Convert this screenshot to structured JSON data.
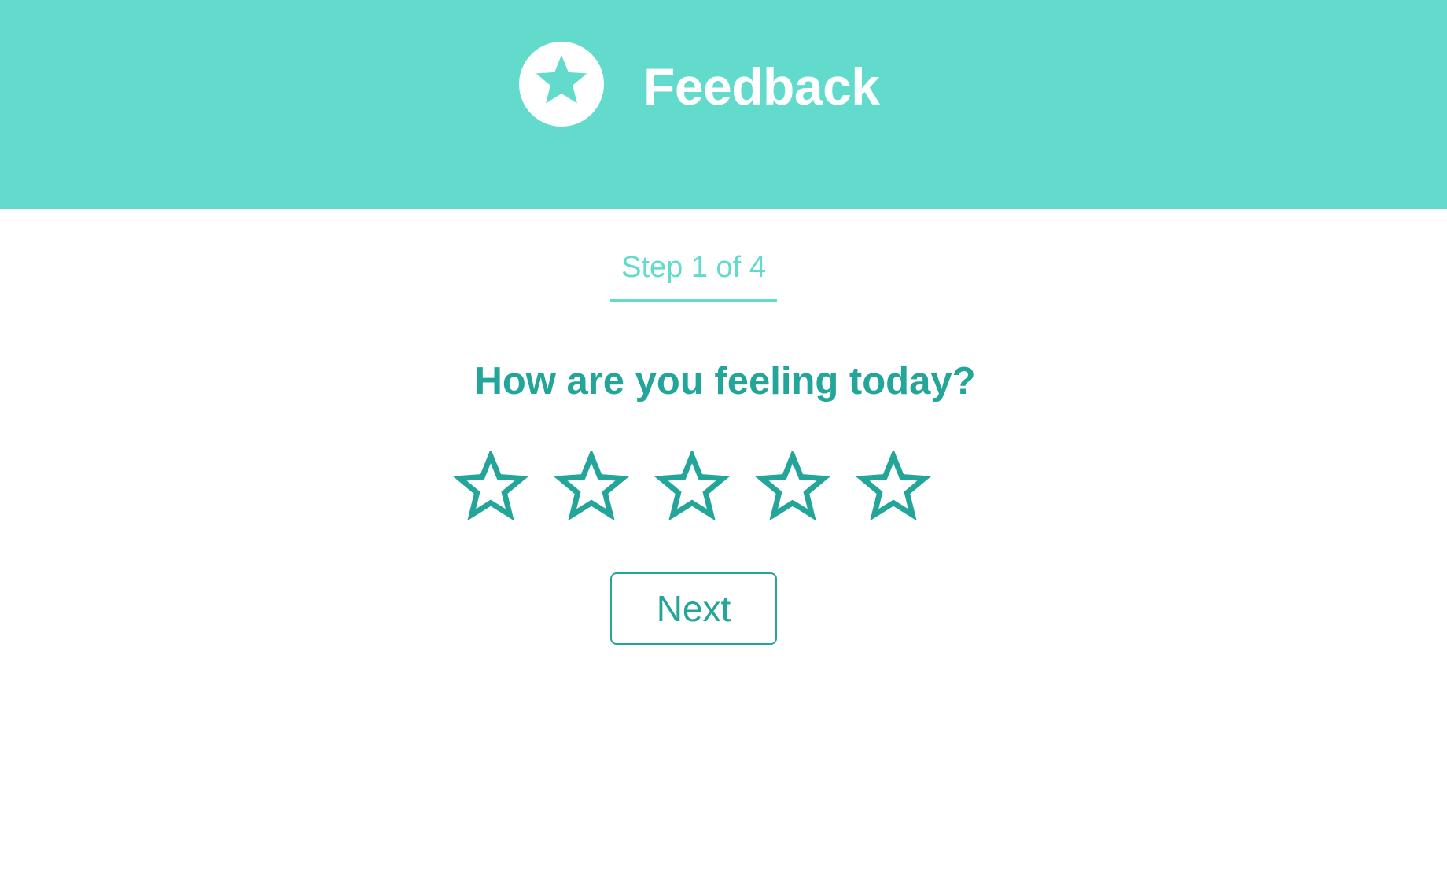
{
  "header": {
    "title": "Feedback",
    "logo_icon": "star-icon",
    "background_color": "#62dbcd"
  },
  "step": {
    "label": "Step 1 of 4",
    "current": 1,
    "total": 4
  },
  "question": {
    "text": "How are you feeling today?"
  },
  "rating": {
    "max": 5,
    "selected": 0,
    "icon": "star-outline-icon",
    "color": "#23a699"
  },
  "actions": {
    "next_label": "Next"
  },
  "colors": {
    "accent_light": "#62dbcd",
    "accent_dark": "#23a699"
  }
}
